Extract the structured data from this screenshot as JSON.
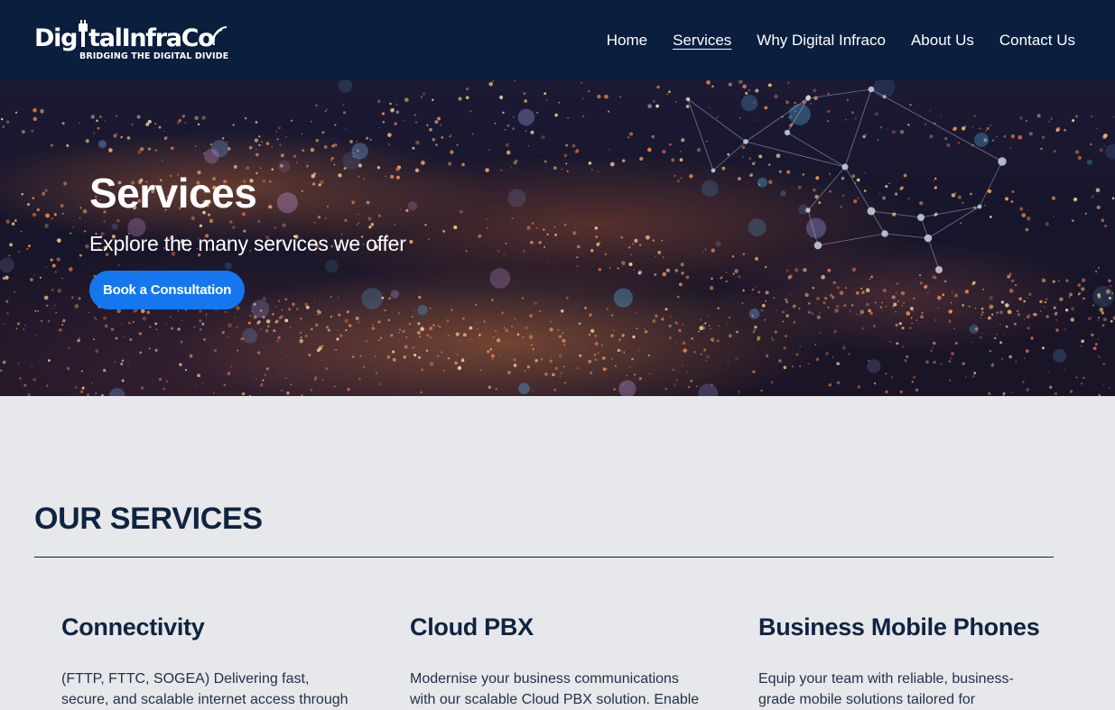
{
  "header": {
    "logo": {
      "wordmark_start": "Dig",
      "wordmark_end": "talInfraCo",
      "tagline": "BRIDGING THE DIGITAL DIVIDE"
    },
    "nav": [
      {
        "label": "Home",
        "active": false
      },
      {
        "label": "Services",
        "active": true
      },
      {
        "label": "Why Digital Infraco",
        "active": false
      },
      {
        "label": "About Us",
        "active": false
      },
      {
        "label": "Contact Us",
        "active": false
      }
    ]
  },
  "hero": {
    "title": "Services",
    "subtitle": "Explore the many services we offer",
    "cta_label": "Book a Consultation"
  },
  "services": {
    "heading": "OUR SERVICES",
    "cards": [
      {
        "title": "Connectivity",
        "description": "(FTTP, FTTC, SOGEA) Delivering fast, secure, and scalable internet access through"
      },
      {
        "title": "Cloud PBX",
        "description": "Modernise your business communications with our scalable Cloud PBX solution. Enable"
      },
      {
        "title": "Business Mobile Phones",
        "description": "Equip your team with reliable, business-grade mobile solutions tailored for"
      }
    ]
  },
  "colors": {
    "header_bg": "#0a1e3e",
    "accent": "#1477f0",
    "heading_text": "#0f2441",
    "page_bg": "#e7e8eb"
  }
}
